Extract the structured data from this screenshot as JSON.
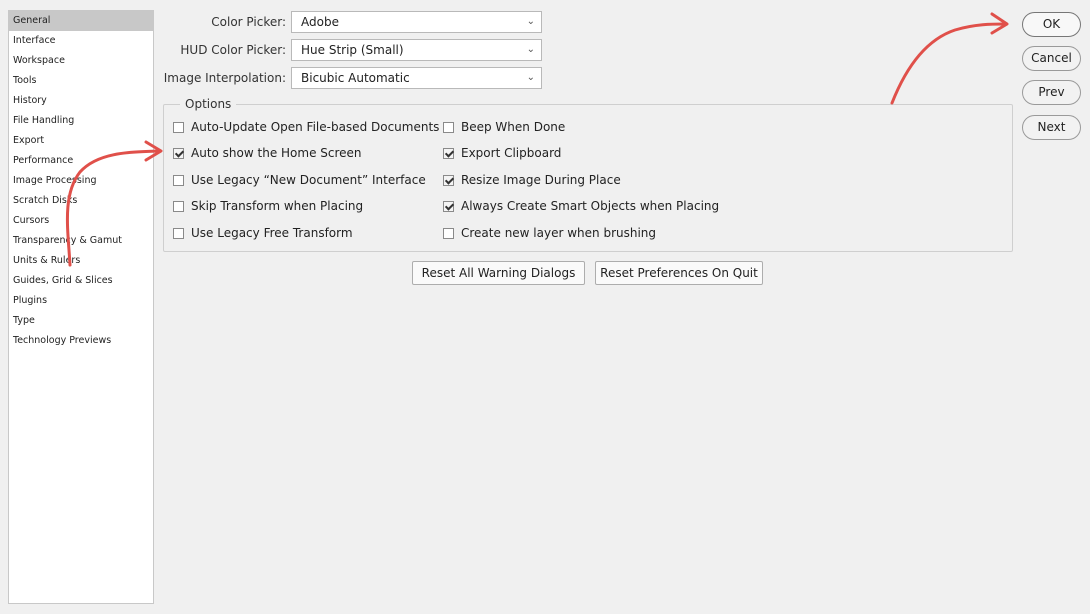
{
  "sidebar": {
    "items": [
      {
        "label": "General",
        "selected": true
      },
      {
        "label": "Interface"
      },
      {
        "label": "Workspace"
      },
      {
        "label": "Tools"
      },
      {
        "label": "History"
      },
      {
        "label": "File Handling"
      },
      {
        "label": "Export"
      },
      {
        "label": "Performance"
      },
      {
        "label": "Image Processing"
      },
      {
        "label": "Scratch Disks"
      },
      {
        "label": "Cursors"
      },
      {
        "label": "Transparency & Gamut"
      },
      {
        "label": "Units & Rulers"
      },
      {
        "label": "Guides, Grid & Slices"
      },
      {
        "label": "Plugins"
      },
      {
        "label": "Type"
      },
      {
        "label": "Technology Previews"
      }
    ]
  },
  "fields": {
    "color_picker": {
      "label": "Color Picker:",
      "value": "Adobe"
    },
    "hud_color_picker": {
      "label": "HUD Color Picker:",
      "value": "Hue Strip (Small)"
    },
    "image_interpolation": {
      "label": "Image Interpolation:",
      "value": "Bicubic Automatic"
    }
  },
  "options": {
    "legend": "Options",
    "left": [
      {
        "label": "Auto-Update Open File-based Documents",
        "checked": false
      },
      {
        "label": "Auto show the Home Screen",
        "checked": true
      },
      {
        "label": "Use Legacy “New Document” Interface",
        "checked": false
      },
      {
        "label": "Skip Transform when Placing",
        "checked": false
      },
      {
        "label": "Use Legacy Free Transform",
        "checked": false
      }
    ],
    "right": [
      {
        "label": "Beep When Done",
        "checked": false
      },
      {
        "label": "Export Clipboard",
        "checked": true
      },
      {
        "label": "Resize Image During Place",
        "checked": true
      },
      {
        "label": "Always Create Smart Objects when Placing",
        "checked": true
      },
      {
        "label": "Create new layer when brushing",
        "checked": false
      }
    ]
  },
  "actions": {
    "reset_warnings": "Reset All Warning Dialogs",
    "reset_prefs": "Reset Preferences On Quit"
  },
  "dialog_buttons": {
    "ok": "OK",
    "cancel": "Cancel",
    "prev": "Prev",
    "next": "Next"
  },
  "annotation_color": "#e0504a"
}
